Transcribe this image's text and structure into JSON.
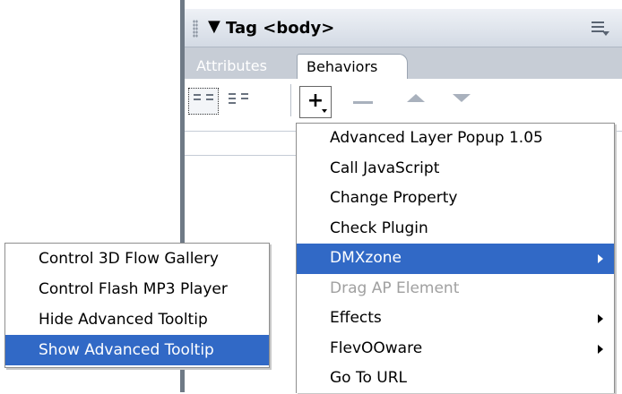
{
  "panel": {
    "collapse_glyph": "▼",
    "title_prefix": "Tag ",
    "title_tag": "<body>",
    "options_icon": "panel-options-menu-icon"
  },
  "tabs": [
    {
      "label": "Attributes",
      "active": false
    },
    {
      "label": "Behaviors",
      "active": true
    }
  ],
  "toolbar": {
    "add_label": "+",
    "buttons": [
      "show-set-events",
      "show-all-events",
      "add-behavior",
      "remove-event",
      "move-up",
      "move-down"
    ]
  },
  "menu": {
    "items": [
      {
        "label": "Advanced Layer Popup 1.05",
        "state": "normal",
        "submenu": false
      },
      {
        "label": "Call JavaScript",
        "state": "normal",
        "submenu": false
      },
      {
        "label": "Change Property",
        "state": "normal",
        "submenu": false
      },
      {
        "label": "Check Plugin",
        "state": "normal",
        "submenu": false
      },
      {
        "label": "DMXzone",
        "state": "highlighted",
        "submenu": true
      },
      {
        "label": "Drag AP Element",
        "state": "disabled",
        "submenu": false
      },
      {
        "label": "Effects",
        "state": "normal",
        "submenu": true
      },
      {
        "label": "FlevOOware",
        "state": "normal",
        "submenu": true
      },
      {
        "label": "Go To URL",
        "state": "normal",
        "submenu": false
      }
    ]
  },
  "submenu": {
    "items": [
      {
        "label": "Control 3D Flow Gallery",
        "state": "normal"
      },
      {
        "label": "Control Flash MP3 Player",
        "state": "normal"
      },
      {
        "label": "Hide Advanced Tooltip",
        "state": "normal"
      },
      {
        "label": "Show Advanced Tooltip",
        "state": "highlighted"
      }
    ]
  },
  "colors": {
    "highlight": "#3169c6",
    "panel_header": "#d3dae4",
    "tab_strip": "#c7cdd6",
    "disabled_text": "#a0a0a0"
  }
}
